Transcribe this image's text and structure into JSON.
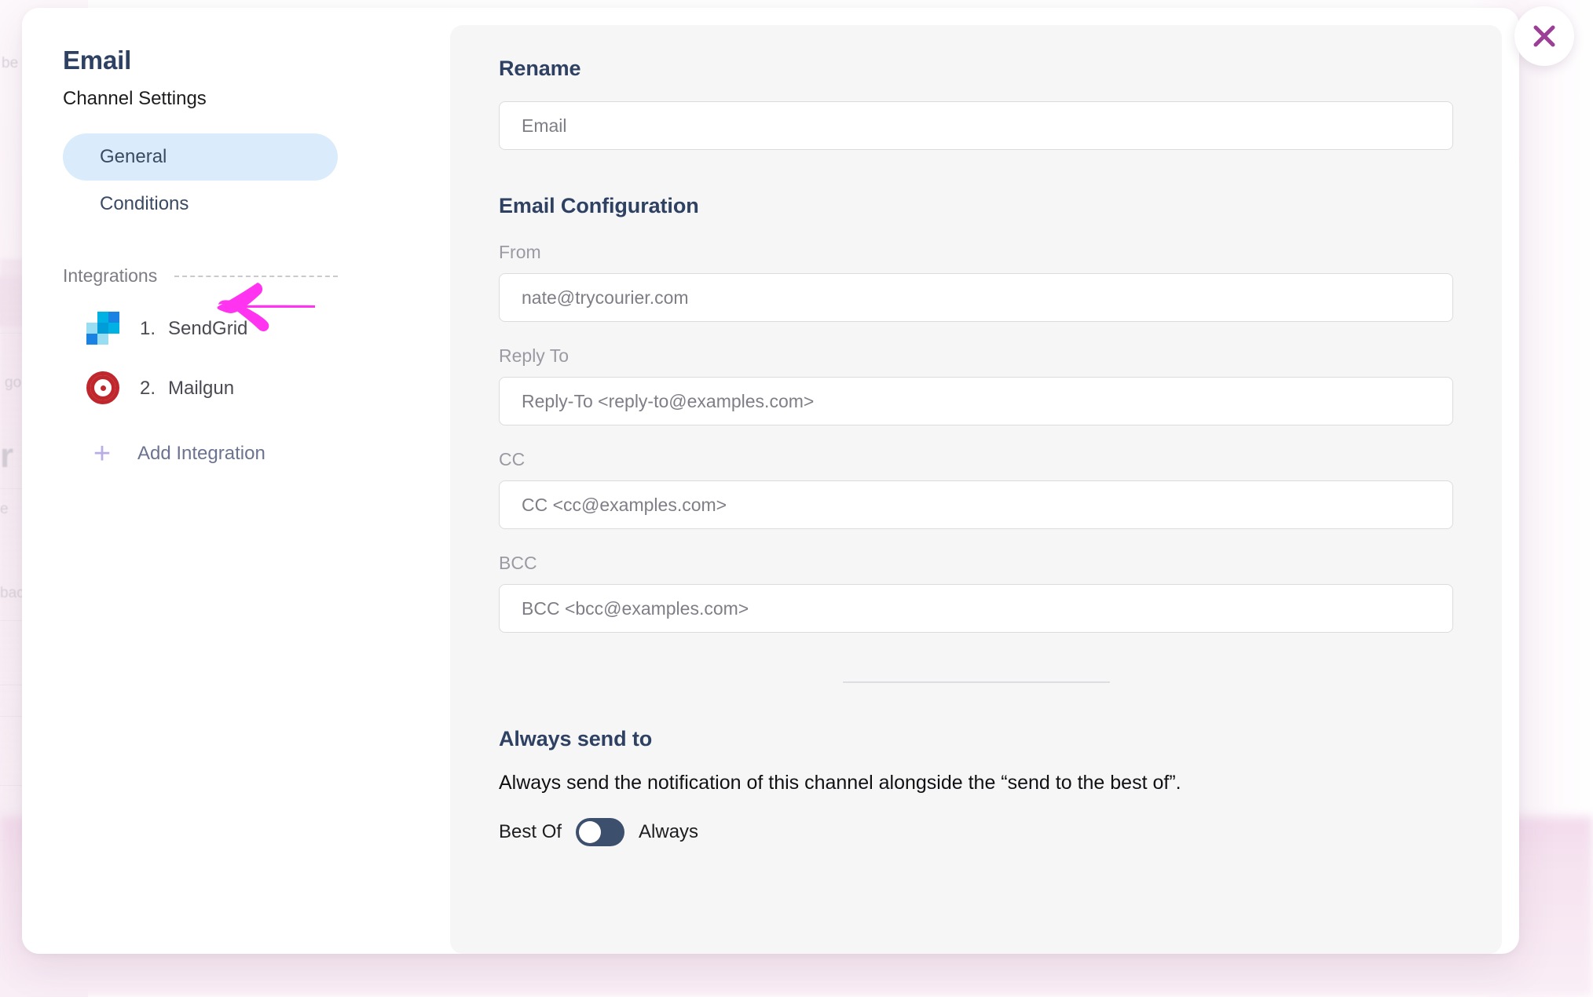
{
  "modal": {
    "close_icon": "close-icon"
  },
  "sidebar": {
    "title": "Email",
    "subtitle": "Channel Settings",
    "nav": [
      {
        "label": "General",
        "active": true
      },
      {
        "label": "Conditions",
        "active": false
      }
    ],
    "integrations_label": "Integrations",
    "integrations": [
      {
        "number": "1.",
        "name": "SendGrid",
        "icon": "sendgrid-logo-icon"
      },
      {
        "number": "2.",
        "name": "Mailgun",
        "icon": "mailgun-logo-icon"
      }
    ],
    "add_integration": {
      "icon": "plus-icon",
      "label": "Add Integration"
    }
  },
  "content": {
    "rename": {
      "heading": "Rename",
      "value": "",
      "placeholder": "Email"
    },
    "email_configuration": {
      "heading": "Email Configuration",
      "fields": [
        {
          "label": "From",
          "value": "",
          "placeholder": "nate@trycourier.com"
        },
        {
          "label": "Reply To",
          "value": "",
          "placeholder": "Reply-To <reply-to@examples.com>"
        },
        {
          "label": "CC",
          "value": "",
          "placeholder": "CC <cc@examples.com>"
        },
        {
          "label": "BCC",
          "value": "",
          "placeholder": "BCC <bcc@examples.com>"
        }
      ]
    },
    "always_send": {
      "heading": "Always send to",
      "description": "Always send the notification of this channel alongside the “send to the best of”.",
      "toggle_left_label": "Best Of",
      "toggle_right_label": "Always",
      "toggle_state": "Best Of"
    }
  },
  "annotation": {
    "arrow_icon": "left-arrow-annotation-icon",
    "arrow_color": "#FF33F0"
  },
  "background": {
    "code_icon": "code-icon",
    "ghost_texts": [
      "be",
      "go",
      "r",
      "e",
      "bac"
    ]
  },
  "colors": {
    "heading_navy": "#2e4162",
    "nav_active_bg": "#daecfb",
    "panel_bg": "#f6f6f7",
    "close_x": "#9b3f97",
    "toggle_on": "#3c4f6d",
    "sendgrid_cyan": "#00b2e3",
    "sendgrid_blue": "#1a82e2",
    "sendgrid_light": "#99ddf3",
    "sendgrid_mid": "#009dd9",
    "mailgun_red": "#c0272d",
    "add_plus": "#b8aee4"
  }
}
